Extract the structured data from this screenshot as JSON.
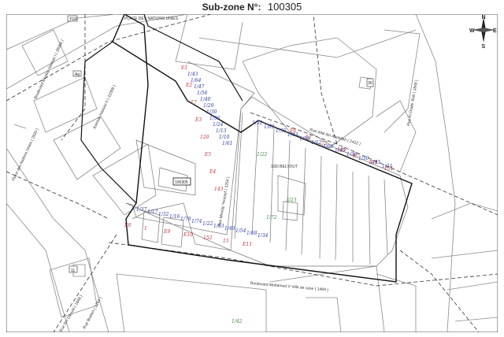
{
  "header": {
    "label": "Sub-zone N°:",
    "zone_id": "100305"
  },
  "compass": {
    "n": "N",
    "s": "S",
    "e": "E",
    "w": "W"
  },
  "colors": {
    "boundary": "#111111",
    "parcel": "#8a8a8a",
    "blue_ink": "#2a3fa3",
    "red_ink": "#c0303b",
    "green_ink": "#3a8a3a",
    "paper": "#ffffff"
  },
  "streets": {
    "place_nations_top": "PLACE DES NATIONS UNIES",
    "bd_hassan": "Boulevard Moulay Hassan I ( 28066 )",
    "av_hassan": "Avenue Hassan II ( 22389 )",
    "place_nations_left": "Place des Nations Unies ( 2830 )",
    "rue_ibn_khaldoun": "Rue Allal ibn Abdellah ( 2422 )",
    "rue_obn": "Rue Al Oraibi Jilali ( 1848 )",
    "rue_monnaie": "Rue Moulay Youssef ( 1254 )",
    "bd_mohamed": "Boulevard Mohamed V Ville de case ( 1469 )",
    "rue_brahim": "Rue Brahim ( 1264 )",
    "rue_daoudi": "Rue Ibn Daoudi ( 1848 )"
  },
  "labels": {
    "zone_tag": "100305",
    "sidi_belyout": "SIDI BELYOUT",
    "road_tag_1": "TGR",
    "road_tag_2": "Ag",
    "road_tag_3": "30",
    "road_tag_4": "11"
  },
  "annotations": {
    "blue": [
      "1/43",
      "1/64",
      "1/47",
      "1/56",
      "1/40",
      "1/29",
      "1/30",
      "1/36",
      "1/24",
      "1/13",
      "1/10",
      "1/61",
      "1/52",
      "1/69",
      "1/36",
      "1/43",
      "1/58",
      "1/12",
      "1/60",
      "1/45",
      "1/38",
      "1/30",
      "1/45",
      "1/21",
      "1/37",
      "1/17",
      "1/32",
      "1/16",
      "1/78",
      "1/74",
      "1/22",
      "1/53",
      "1/40",
      "1/54",
      "1/68",
      "1/34"
    ],
    "red": [
      "E1",
      "E2",
      "17",
      "E3",
      "120",
      "E5",
      "E4",
      "143",
      "E6",
      "12",
      "72",
      "145",
      "E7",
      "141",
      "151",
      "E8",
      "1",
      "E9",
      "E10",
      "152",
      "15",
      "E11"
    ],
    "green": [
      "1/22",
      "1/72",
      "3/23",
      "1/42"
    ]
  }
}
